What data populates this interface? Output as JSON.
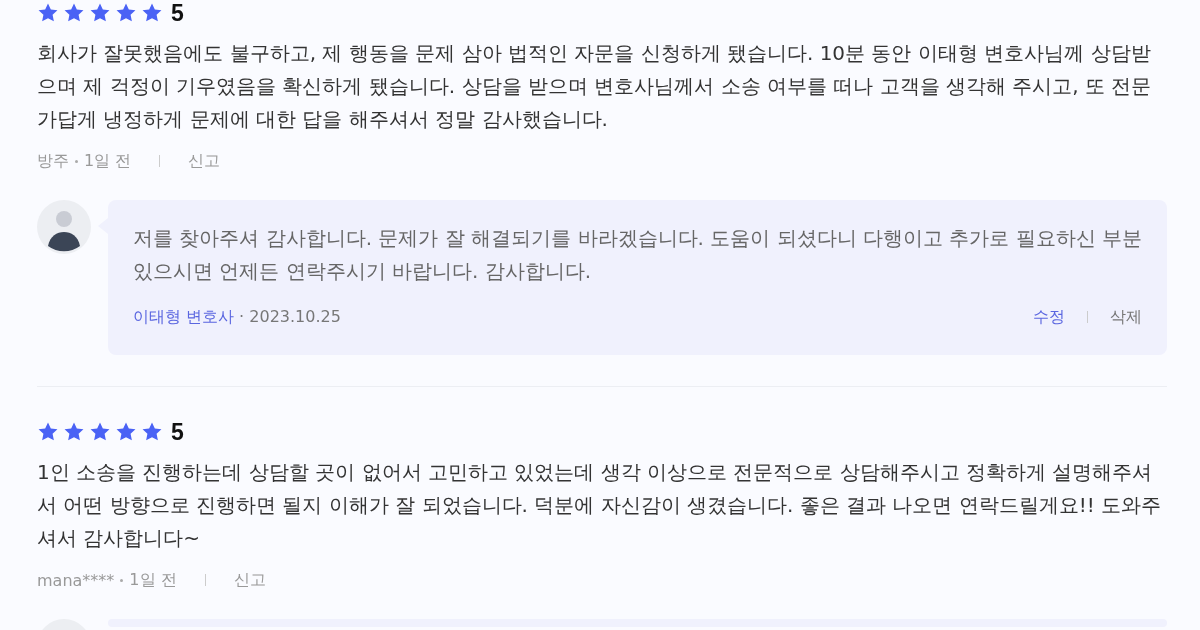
{
  "reviews": [
    {
      "stars": 5,
      "score": "5",
      "text": "회사가 잘못했음에도 불구하고, 제 행동을 문제 삼아 법적인 자문을 신청하게 됐습니다. 10분 동안 이태형 변호사님께 상담받으며 제 걱정이 기우였음을 확신하게 됐습니다. 상담을 받으며 변호사님께서 소송 여부를 떠나 고객을 생각해 주시고, 또 전문가답게 냉정하게 문제에 대한 답을 해주셔서 정말 감사했습니다.",
      "author": "방주",
      "time": "1일 전",
      "report": "신고",
      "replied": true,
      "reply": {
        "text": "저를 찾아주셔 감사합니다. 문제가 잘 해결되기를 바라겠습니다. 도움이 되셨다니 다행이고 추가로 필요하신 부분 있으시면 언제든 연락주시기 바랍니다. 감사합니다.",
        "author": "이태형 변호사",
        "date": "· 2023.10.25",
        "edit": "수정",
        "delete": "삭제"
      }
    },
    {
      "stars": 5,
      "score": "5",
      "text": "1인 소송을 진행하는데 상담할 곳이 없어서 고민하고 있었는데 생각 이상으로 전문적으로 상담해주시고 정확하게 설명해주셔서 어떤 방향으로 진행하면 될지 이해가 잘 되었습니다. 덕분에 자신감이 생겼습니다. 좋은 결과 나오면 연락드릴게요!! 도와주셔서 감사합니다~",
      "author": "mana****",
      "time": "1일 전",
      "report": "신고",
      "replied": true
    }
  ]
}
